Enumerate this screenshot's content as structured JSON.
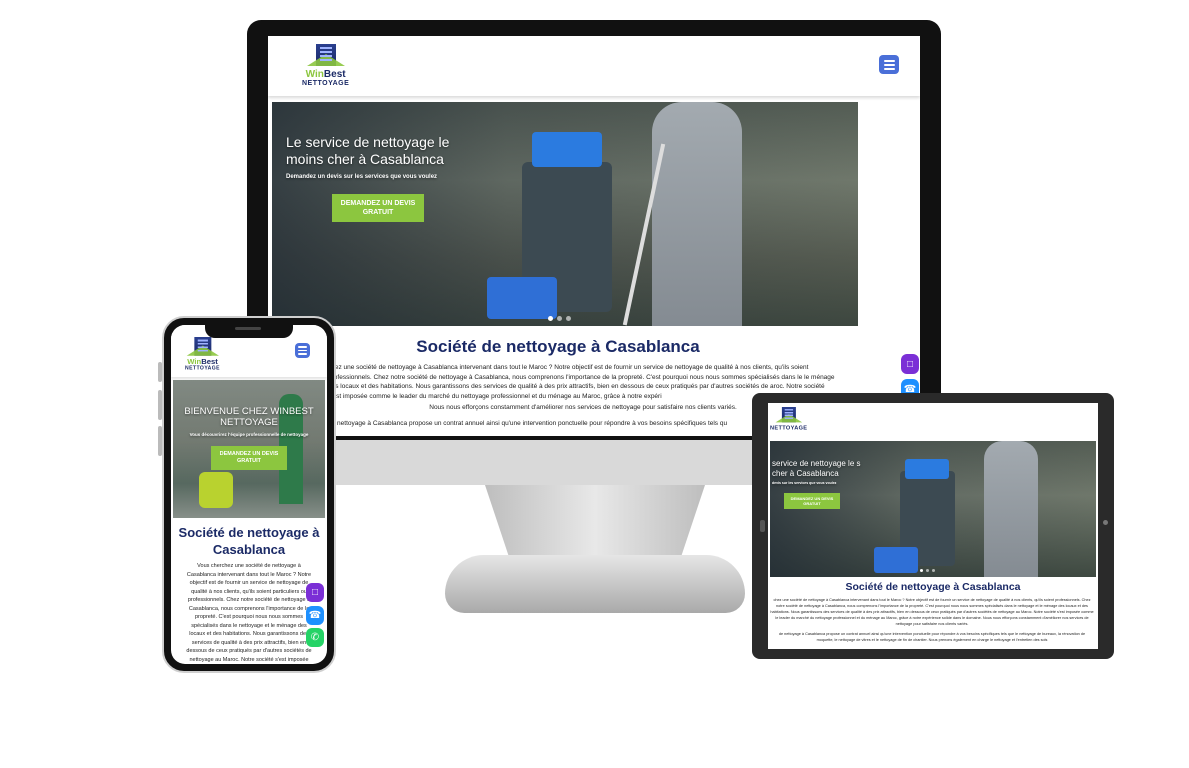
{
  "brand": {
    "wordmark_a": "Win",
    "wordmark_b": "Best",
    "sub": "NETTOYAGE"
  },
  "colors": {
    "brand_navy": "#1b2a66",
    "accent_green": "#8cc63f",
    "menu_blue": "#4a6fd8",
    "chat_purple": "#7b2fd6",
    "phone_blue": "#1e90ff",
    "whatsapp_green": "#25d366"
  },
  "icons": {
    "menu": "hamburger-icon",
    "chat": "chat-icon",
    "phone": "phone-icon",
    "whatsapp": "whatsapp-icon"
  },
  "desktop": {
    "hero_title": "Le service de nettoyage le moins cher à Casablanca",
    "hero_sub": "Demandez un devis sur les services que vous voulez",
    "cta": "DEMANDEZ UN DEVIS GRATUIT",
    "section_title": "Société de nettoyage à Casablanca",
    "para_1": "chez une société de nettoyage à Casablanca intervenant dans tout le Maroc ? Notre objectif est de fournir un service de nettoyage de qualité à nos clients, qu'ils soient professionnels. Chez notre société de nettoyage à Casablanca, nous comprenons l'importance de la propreté. C'est pourquoi nous nous sommes spécialisés dans le le ménage des locaux et des habitations. Nous garantissons des services de qualité à des prix attractifs, bien en dessous de ceux pratiqués par d'autres sociétés de aroc. Notre société s'est imposée comme le leader du marché du nettoyage professionnel et du ménage au Maroc, grâce à notre expéri",
    "para_2": "Nous nous efforçons constamment d'améliorer nos services de nettoyage pour satisfaire nos clients variés.",
    "para_3": "de nettoyage à Casablanca propose un contrat annuel ainsi qu'une intervention ponctuelle pour répondre à vos besoins spécifiques tels qu"
  },
  "tablet": {
    "hero_title": "service de nettoyage le s cher à Casablanca",
    "hero_sub": "devis sur les services que vous voulez",
    "cta": "DEMANDEZ UN DEVIS GRATUIT",
    "section_title": "Société de nettoyage à Casablanca",
    "para_1": "chez une société de nettoyage à Casablanca intervenant dans tout le Maroc ? Notre objectif est de fournir un service de nettoyage de qualité à nos clients, qu'ils soient professionnels. Chez notre société de nettoyage à Casablanca, nous comprenons l'importance de la propreté. C'est pourquoi nous nous sommes spécialisés dans le nettoyage et le ménage des locaux et des habitations. Nous garantissons des services de qualité à des prix attractifs, bien en dessous de ceux pratiqués par d'autres sociétés de nettoyage au Maroc. Notre société s'est imposée comme le leader du marché du nettoyage professionnel et du ménage au Maroc, grâce à notre expérience solide dans le domaine. Nous nous efforçons constamment d'améliorer nos services de nettoyage pour satisfaire nos clients variés.",
    "para_2": "de nettoyage à Casablanca propose un contrat annuel ainsi qu'une intervention ponctuelle pour répondre à vos besoins spécifiques tels que le nettoyage de bureaux, la rénovation de moquette, le nettoyage de vitres et le nettoyage de fin de chantier. Nous prenons également en charge le nettoyage et l'entretien des sols"
  },
  "phone": {
    "hero_title": "BIENVENUE CHEZ WINBEST NETTOYAGE",
    "hero_sub": "Vous découvrirez l'équipe professionnelle de nettoyage",
    "cta": "DEMANDEZ UN DEVIS GRATUIT",
    "section_title": "Société de nettoyage à Casablanca",
    "para": "Vous cherchez une société de nettoyage à Casablanca intervenant dans tout le Maroc ? Notre objectif est de fournir un service de nettoyage de qualité à nos clients, qu'ils soient particuliers ou professionnels. Chez notre société de nettoyage à Casablanca, nous comprenons l'importance de la propreté. C'est pourquoi nous nous sommes spécialisés dans le nettoyage et le ménage des locaux et des habitations. Nous garantissons des services de qualité à des prix attractifs, bien en dessous de ceux pratiqués par d'autres sociétés de nettoyage au Maroc. Notre société s'est imposée"
  }
}
